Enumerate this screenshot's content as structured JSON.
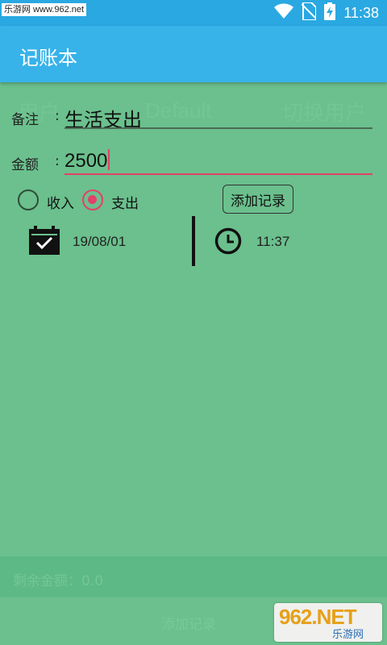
{
  "status_bar": {
    "watermark": "乐游网 www.962.net",
    "time": "11:38",
    "icons": [
      "wifi-icon",
      "no-sim-icon",
      "battery-charging-icon"
    ]
  },
  "app_bar": {
    "title": "记账本"
  },
  "background": {
    "user_label": "用户",
    "user_value": "Default",
    "switch_user": "切换用户",
    "remaining": "剩余金额：0.0",
    "add_record_bottom": "添加记录"
  },
  "form": {
    "note_label": "备注",
    "amount_label": "金额",
    "colon": ":",
    "note_value": "生活支出",
    "amount_value": "2500",
    "radio_income": "收入",
    "radio_expense": "支出",
    "selected": "支出",
    "add_button": "添加记录",
    "date": "19/08/01",
    "time": "11:37"
  },
  "colors": {
    "status_bar": "#2aa8e2",
    "app_bar": "#37b3ea",
    "overlay": "#6bc08d",
    "accent": "#e4406a"
  },
  "watermark_bottom": {
    "big": "962.NET",
    "small": "乐游网"
  }
}
